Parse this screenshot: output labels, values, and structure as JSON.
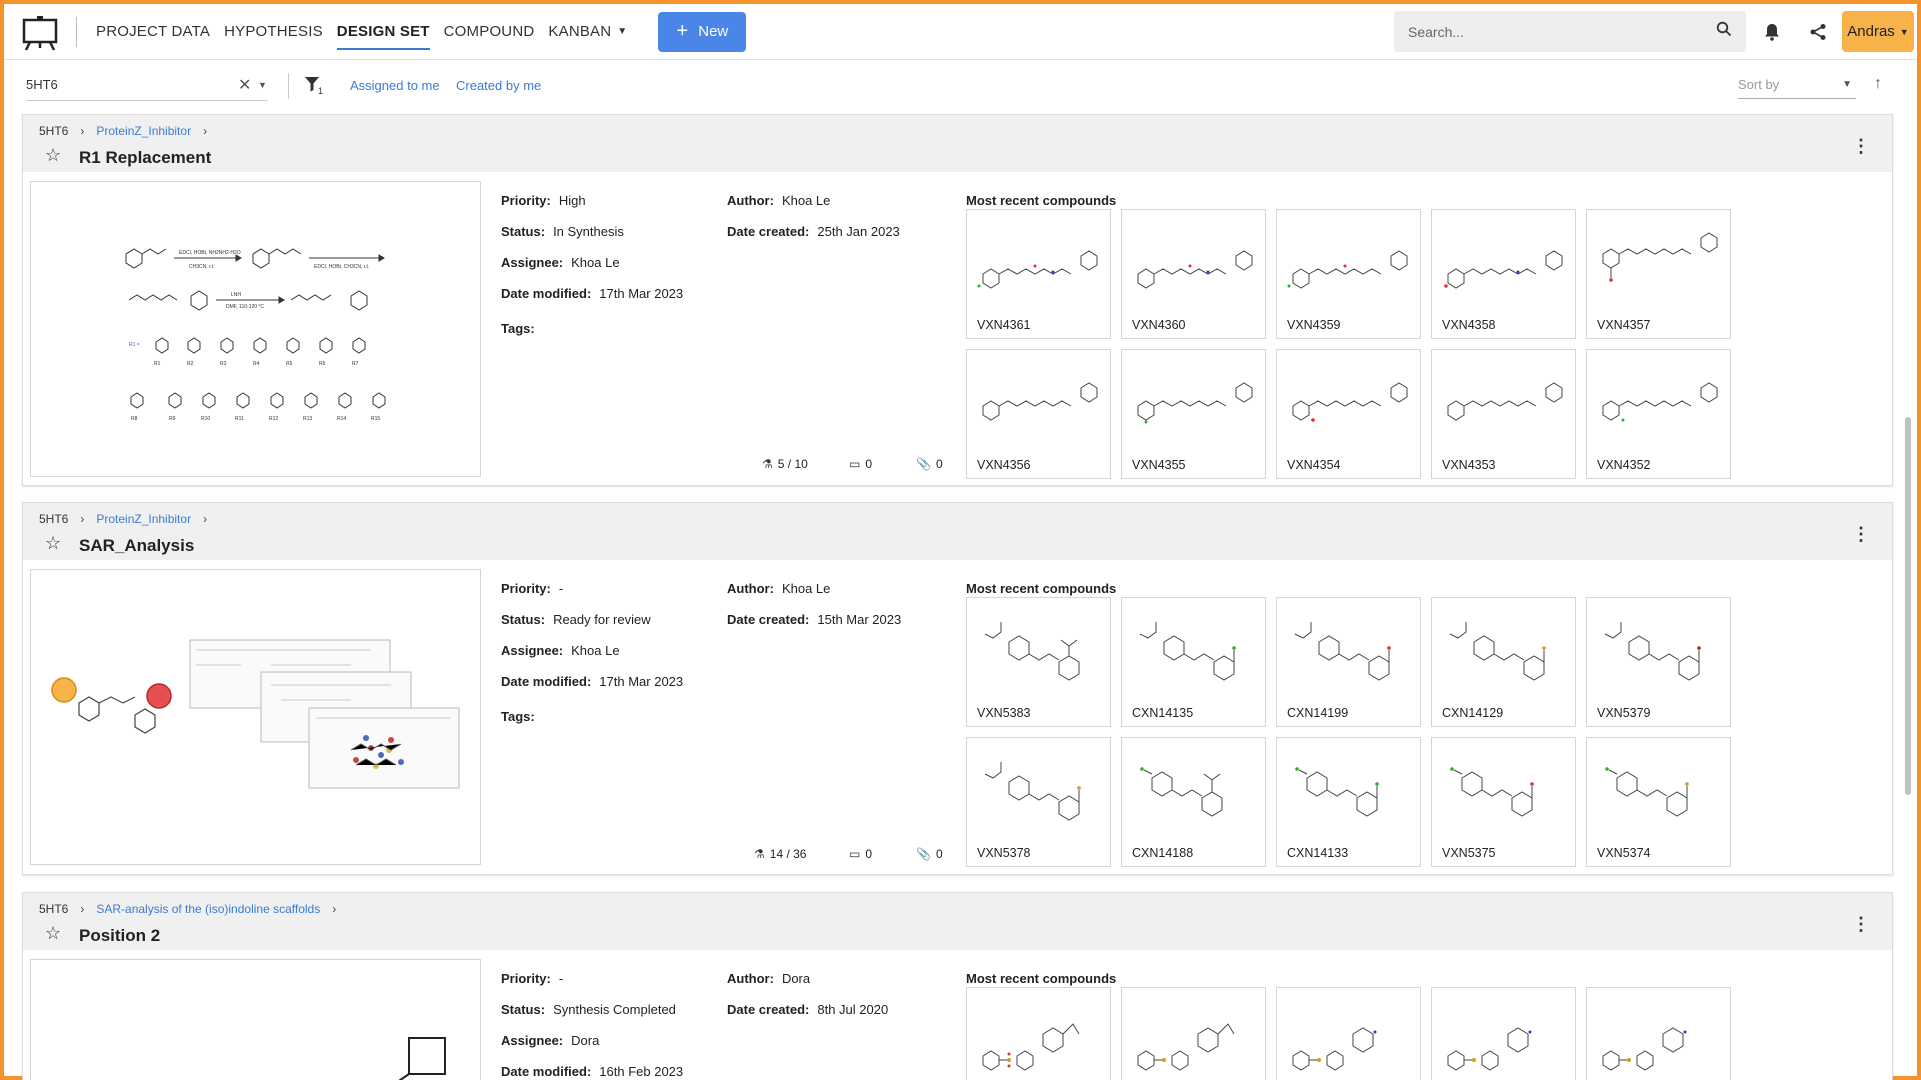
{
  "nav": {
    "items": [
      "PROJECT DATA",
      "HYPOTHESIS",
      "DESIGN SET",
      "COMPOUND",
      "KANBAN"
    ],
    "active": "DESIGN SET",
    "new_label": "New",
    "search_placeholder": "Search...",
    "user": "Andras"
  },
  "filters": {
    "project": "5HT6",
    "assigned": "Assigned to me",
    "created": "Created by me",
    "sort_placeholder": "Sort by"
  },
  "labels": {
    "priority": "Priority:",
    "status": "Status:",
    "assignee": "Assignee:",
    "date_modified": "Date modified:",
    "tags": "Tags:",
    "author": "Author:",
    "date_created": "Date created:",
    "most_recent": "Most recent compounds"
  },
  "cards": [
    {
      "project": "5HT6",
      "hypothesis": "ProteinZ_Inhibitor",
      "title": "R1 Replacement",
      "priority": "High",
      "status": "In Synthesis",
      "assignee": "Khoa Le",
      "date_modified": "17th Mar 2023",
      "author": "Khoa Le",
      "date_created": "25th Jan 2023",
      "progress": "5 / 10",
      "comments": "0",
      "attachments": "0",
      "compounds": [
        "VXN4361",
        "VXN4360",
        "VXN4359",
        "VXN4358",
        "VXN4357",
        "VXN4356",
        "VXN4355",
        "VXN4354",
        "VXN4353",
        "VXN4352"
      ]
    },
    {
      "project": "5HT6",
      "hypothesis": "ProteinZ_Inhibitor",
      "title": "SAR_Analysis",
      "priority": "-",
      "status": "Ready for review",
      "assignee": "Khoa Le",
      "date_modified": "17th Mar 2023",
      "author": "Khoa Le",
      "date_created": "15th Mar 2023",
      "progress": "14 / 36",
      "comments": "0",
      "attachments": "0",
      "compounds": [
        "VXN5383",
        "CXN14135",
        "CXN14199",
        "CXN14129",
        "VXN5379",
        "VXN5378",
        "CXN14188",
        "CXN14133",
        "VXN5375",
        "VXN5374"
      ]
    },
    {
      "project": "5HT6",
      "hypothesis": "SAR-analysis of the (iso)indoline scaffolds",
      "title": "Position 2",
      "priority": "-",
      "status": "Synthesis Completed",
      "assignee": "Dora",
      "date_modified": "16th Feb 2023",
      "author": "Dora",
      "date_created": "8th Jul 2020",
      "compounds": []
    }
  ],
  "colors": {
    "accent": "#4a86e8",
    "user": "#f7b24a",
    "frame": "#f5922a",
    "link": "#3a7bd5"
  }
}
